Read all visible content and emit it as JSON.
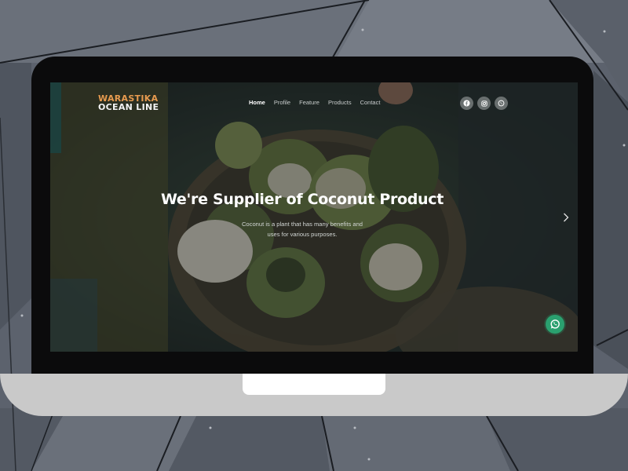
{
  "brand": {
    "line1": "WARASTIKA",
    "line2": "OCEAN LINE",
    "accent_color": "#e69a4f"
  },
  "nav": {
    "items": [
      {
        "label": "Home",
        "active": true
      },
      {
        "label": "Profile",
        "active": false
      },
      {
        "label": "Feature",
        "active": false
      },
      {
        "label": "Products",
        "active": false
      },
      {
        "label": "Contact",
        "active": false
      }
    ]
  },
  "socials": [
    {
      "icon": "facebook-icon"
    },
    {
      "icon": "instagram-icon"
    },
    {
      "icon": "whatsapp-icon"
    }
  ],
  "hero": {
    "title": "We're Supplier of Coconut Product",
    "subtitle_line1": "Coconut is a plant that has many benefits and",
    "subtitle_line2": "uses for various purposes."
  },
  "controls": {
    "next_icon": "chevron-right-icon",
    "chat_icon": "whatsapp-icon",
    "chat_color": "#2aa06f"
  }
}
